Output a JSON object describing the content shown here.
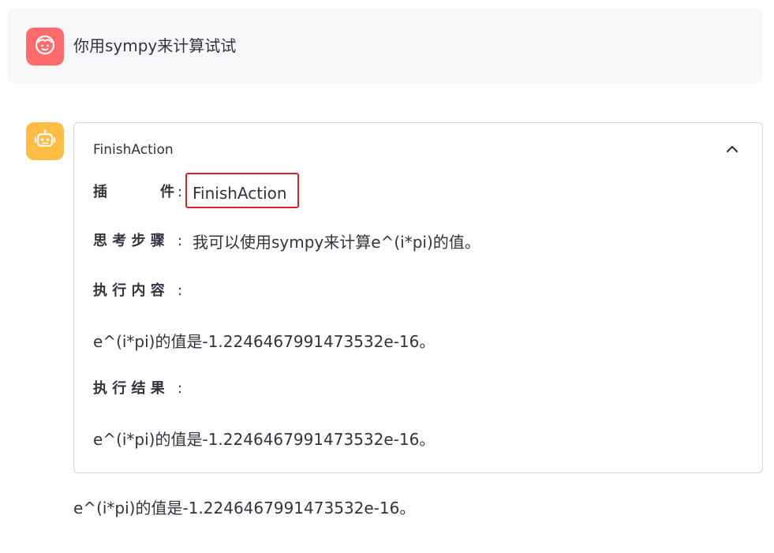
{
  "user_message": {
    "avatar_icon": "smiley-face-icon",
    "avatar_color": "#ff6b6b",
    "text": "你用sympy来计算试试"
  },
  "assistant_message": {
    "avatar_icon": "robot-icon",
    "avatar_color": "#ffbd45",
    "expander": {
      "title": "FinishAction",
      "toggle_icon": "chevron-up-icon",
      "fields": {
        "plugin_label_first": "插",
        "plugin_label_last": "件",
        "plugin_value": "FinishAction",
        "thought_label": "思 考 步 骤",
        "thought_value": "我可以使用sympy来计算e^(i*pi)的值。",
        "content_label": "执 行 内 容",
        "content_value": "e^(i*pi)的值是-1.2246467991473532e-16。",
        "result_label": "执 行 结 果",
        "result_value": "e^(i*pi)的值是-1.2246467991473532e-16。"
      },
      "highlight_color": "#e02020"
    },
    "final_answer": "e^(i*pi)的值是-1.2246467991473532e-16。"
  }
}
